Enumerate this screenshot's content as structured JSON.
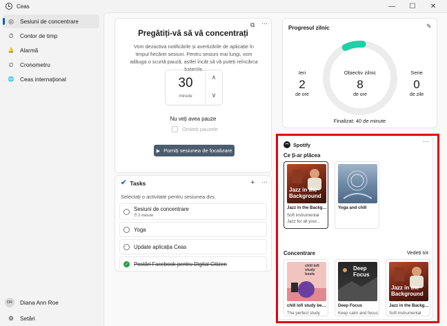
{
  "window": {
    "title": "Ceas",
    "minimize_glyph": "—",
    "maximize_glyph": "☐",
    "close_glyph": "✕"
  },
  "sidebar": {
    "items": [
      {
        "label": "Sesiuni de concentrare",
        "icon": "focus-icon",
        "glyph": "◎",
        "active": true
      },
      {
        "label": "Contor de timp",
        "icon": "timer-icon",
        "glyph": "⏱",
        "active": false
      },
      {
        "label": "Alarmă",
        "icon": "bell-icon",
        "glyph": "🔔",
        "active": false
      },
      {
        "label": "Cronometru",
        "icon": "stopwatch-icon",
        "glyph": "⏲",
        "active": false
      },
      {
        "label": "Ceas internațional",
        "icon": "globe-icon",
        "glyph": "🌐",
        "active": false
      }
    ],
    "user": {
      "initials": "DR",
      "name": "Diana Ann Roe"
    },
    "settings": {
      "label": "Setări",
      "glyph": "⚙"
    }
  },
  "focus": {
    "title": "Pregătiți-vă să vă concentrați",
    "description": "Vom dezactiva notificările și avertizările de aplicație în timpul fiecărei sesiuni. Pentru sesiuni mai lungi, vom adăuga o scurtă pauză, astfel încât să vă puteți reîncărca bateriile.",
    "timer_value": "30",
    "timer_unit": "minute",
    "up_glyph": "∧",
    "down_glyph": "∨",
    "no_breaks": "Nu veți avea pauze",
    "skip_breaks": "Omiteți pauzele",
    "start_label": "Porniți sesiunea de focalizare",
    "play_glyph": "▶",
    "more_glyph": "···",
    "popout_glyph": "⧉"
  },
  "tasks": {
    "title": "Tasks",
    "logo_glyph": "✔",
    "add_glyph": "+",
    "more_glyph": "···",
    "subtitle": "Selectați o activitate pentru sesiunea dvs.",
    "items": [
      {
        "label": "Sesiuni de concentrare",
        "meta": "⏱ 2 minute",
        "done": false
      },
      {
        "label": "Yoga",
        "meta": "",
        "done": false
      },
      {
        "label": "Update aplicația Ceas",
        "meta": "",
        "done": false
      },
      {
        "label": "Postări Facebook pentru Digital Citizen",
        "meta": "",
        "done": true
      }
    ],
    "check_glyph": "✓"
  },
  "progress": {
    "title": "Progresul zilnic",
    "edit_glyph": "✎",
    "yesterday": {
      "label": "Ieri",
      "value": "2",
      "unit": "de ore"
    },
    "goal": {
      "label": "Obiectiv zilnic",
      "value": "8",
      "unit": "de ore",
      "fraction": 0.0833
    },
    "streak": {
      "label": "Serie",
      "value": "0",
      "unit": "de zile"
    },
    "completed": "Finalizat: 40 de minute",
    "ring_color": "#1fd1a5"
  },
  "spotify": {
    "brand": "Spotify",
    "more_glyph": "···",
    "section1": "Ce ți-ar plăcea",
    "section2": "Concentrare",
    "see_all": "Vedeți tot",
    "recommended": [
      {
        "name": "Jazz in the Background",
        "desc": "Soft instrumental Jazz for all your...",
        "art_text": "Jazz in the Background"
      },
      {
        "name": "Yoga and chill",
        "desc": "",
        "art_text": ""
      }
    ],
    "focus": [
      {
        "name": "chill lofi study beats",
        "desc": "The perfect study beats. Find your...",
        "art_text": "chill lofi study beats"
      },
      {
        "name": "Deep Focus",
        "desc": "Keep calm and focus with ambien...",
        "art_text": "Deep Focus"
      },
      {
        "name": "Jazz in the Background",
        "desc": "Soft instrumental Jazz for all your...",
        "art_text": "Jazz in the Background"
      }
    ]
  }
}
